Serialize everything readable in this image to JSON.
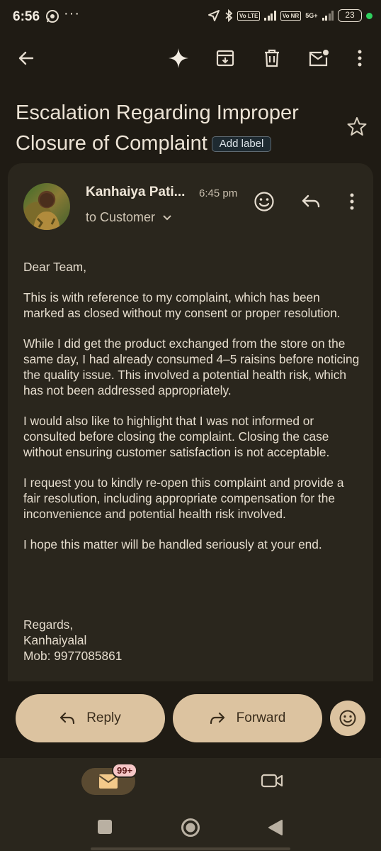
{
  "status_bar": {
    "time": "6:56",
    "volte1": "Vo LTE",
    "volte2": "Vo NR",
    "network": "5G+",
    "battery": "23"
  },
  "email": {
    "subject": "Escalation Regarding Improper Closure of Complaint",
    "add_label": "Add label",
    "sender": "Kanhaiya Pati...",
    "time": "6:45 pm",
    "recipient": "to Customer",
    "body": [
      "Dear Team,",
      "This is with reference to my complaint, which has been marked as closed without my consent or proper resolution.",
      "While I did get the product exchanged from the store on the same day, I had already consumed 4–5 raisins before noticing the quality issue. This involved a potential health risk, which has not been addressed appropriately.",
      "I would also like to highlight that I was not informed or consulted before closing the complaint. Closing the case without ensuring customer satisfaction is not acceptable.",
      "I request you to kindly re-open this complaint and provide a fair resolution, including appropriate compensation for the inconvenience and potential health risk involved.",
      "I hope this matter will be handled seriously at your end."
    ],
    "signature": [
      "Regards,",
      "Kanhaiyalal",
      "Mob: 9977085861"
    ]
  },
  "actions": {
    "reply": "Reply",
    "forward": "Forward"
  },
  "nav": {
    "mail_badge": "99+"
  },
  "colors": {
    "background": "#1f1b14",
    "card": "#2a261d",
    "pill": "#dcc3a0",
    "accent_green": "#2fd15f"
  },
  "icons": [
    "back-arrow-icon",
    "sparkle-icon",
    "archive-icon",
    "delete-icon",
    "mark-unread-icon",
    "more-vert-icon",
    "star-icon",
    "emoji-icon",
    "reply-icon",
    "forward-icon",
    "mail-icon",
    "video-icon"
  ]
}
